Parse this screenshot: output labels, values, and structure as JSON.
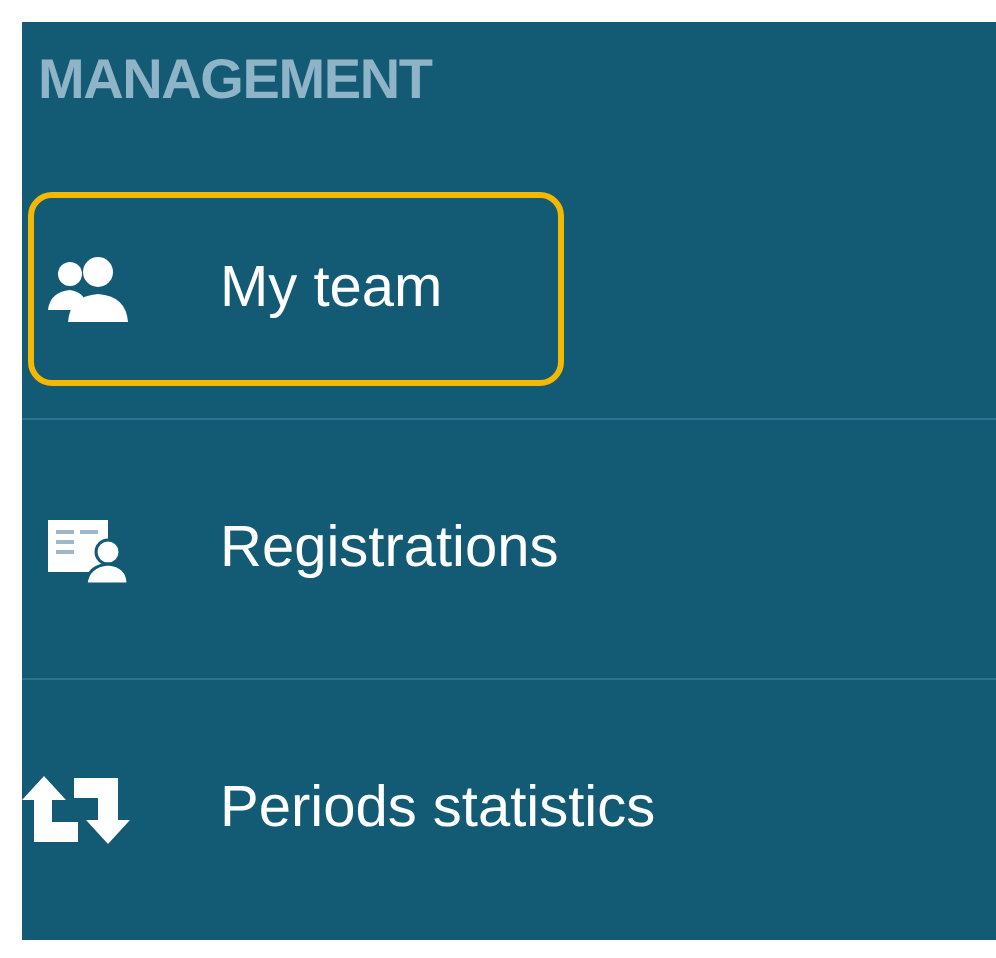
{
  "sidebar": {
    "heading": "MANAGEMENT",
    "items": [
      {
        "label": "My team",
        "kind": "team",
        "selected": true
      },
      {
        "label": "Registrations",
        "kind": "registrations",
        "selected": false
      },
      {
        "label": "Periods statistics",
        "kind": "periods",
        "selected": false
      }
    ]
  }
}
